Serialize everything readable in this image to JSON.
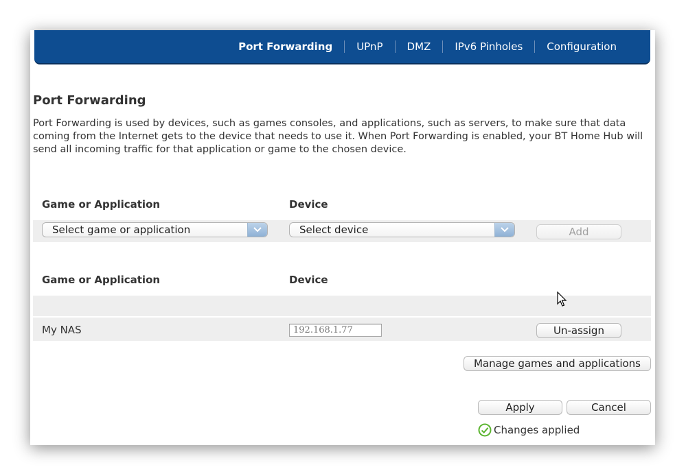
{
  "nav": {
    "items": [
      {
        "label": "Port Forwarding"
      },
      {
        "label": "UPnP"
      },
      {
        "label": "DMZ"
      },
      {
        "label": "IPv6 Pinholes"
      },
      {
        "label": "Configuration"
      }
    ]
  },
  "page": {
    "title": "Port Forwarding",
    "description": "Port Forwarding is used by devices, such as games consoles, and applications, such as servers, to make sure that data coming from the Internet gets to the device that needs to use it. When Port Forwarding is enabled, your BT Home Hub will send all incoming traffic for that application or game to the chosen device."
  },
  "add_form": {
    "col_game": "Game or Application",
    "col_device": "Device",
    "game_select": "Select game or application",
    "device_select": "Select device",
    "add_label": "Add"
  },
  "assigned": {
    "col_game": "Game or Application",
    "col_device": "Device",
    "rows": [
      {
        "name": "My NAS",
        "ip": "192.168.1.77",
        "action": "Un-assign"
      }
    ]
  },
  "actions": {
    "manage_label": "Manage games and applications",
    "apply_label": "Apply",
    "cancel_label": "Cancel"
  },
  "status": {
    "text": "Changes applied",
    "color": "#5cb531"
  },
  "colors": {
    "nav_bg": "#0e4d91",
    "band_bg": "#eeeeee"
  }
}
